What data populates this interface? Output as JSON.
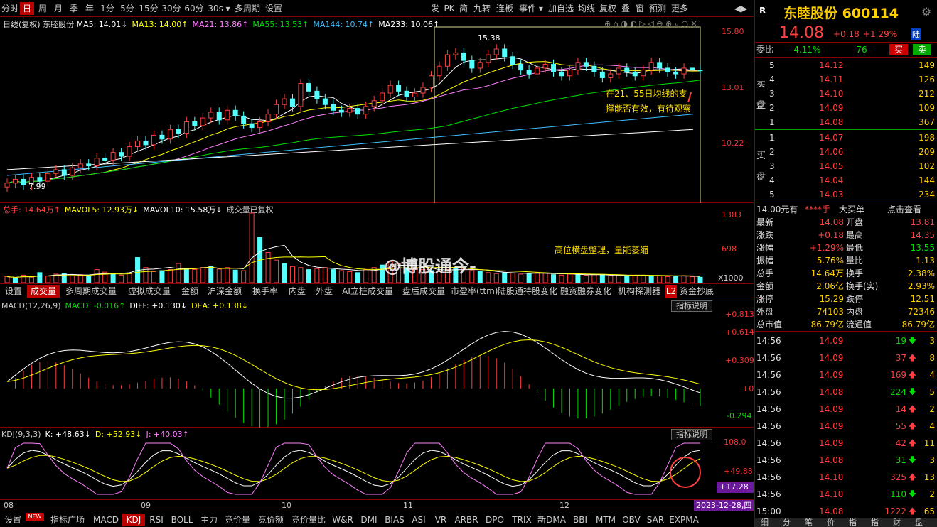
{
  "toolbar": {
    "left": [
      "分时",
      "日",
      "周",
      "月",
      "季",
      "年",
      "1分",
      "5分",
      "15分",
      "30分",
      "60分",
      "30s ▾",
      "多周期",
      "设置"
    ],
    "selected": "日",
    "right": [
      "发",
      "PK",
      "简",
      "九转",
      "连板",
      "事件 ▾",
      "加自选",
      "均线",
      "复权",
      "叠",
      "窗",
      "预测",
      "更多"
    ],
    "nav": "◀▶"
  },
  "main": {
    "mode": "日线(复权)",
    "name": "东睦股份",
    "ma": [
      {
        "t": "MA5: 14.01↓",
        "c": "#ffffff"
      },
      {
        "t": "MA13: 14.00↑",
        "c": "#ffff00"
      },
      {
        "t": "MA21: 13.86↑",
        "c": "#ff80ff"
      },
      {
        "t": "MA55: 13.53↑",
        "c": "#00e000"
      },
      {
        "t": "MA144: 10.74↑",
        "c": "#40c0ff"
      },
      {
        "t": "MA233: 10.06↑",
        "c": "#ffffff"
      }
    ],
    "yaxis": [
      "15.80",
      "13.01",
      "10.22"
    ],
    "high_label": "15.38",
    "low_label": "7.99",
    "annotation": [
      "在21、55日均线的支",
      "撑能否有效，有待观察"
    ],
    "candles": [
      8.2,
      8.4,
      8.1,
      8.5,
      8.3,
      8.7,
      8.9,
      8.6,
      9.0,
      9.2,
      9.1,
      9.5,
      9.4,
      9.8,
      9.6,
      10.1,
      10.4,
      10.2,
      10.7,
      10.5,
      11.0,
      10.8,
      11.4,
      11.2,
      11.6,
      11.9,
      11.5,
      12.0,
      11.7,
      11.3,
      11.1,
      11.4,
      11.8,
      12.3,
      12.6,
      12.2,
      13.4,
      13.0,
      12.6,
      12.3,
      12.0,
      11.9,
      12.1,
      11.8,
      12.2,
      12.5,
      12.9,
      13.3,
      13.0,
      12.7,
      12.9,
      13.2,
      13.8,
      14.3,
      14.9,
      15.0,
      14.6,
      14.2,
      14.5,
      14.9,
      15.2,
      14.8,
      14.4,
      14.1,
      13.9,
      14.2,
      14.4,
      14.0,
      13.8,
      14.1,
      14.5,
      14.3,
      14.0,
      13.7,
      13.9,
      14.2,
      14.0,
      13.8,
      14.1,
      14.5,
      14.2,
      14.0,
      13.9,
      14.2,
      14.1,
      14.08
    ]
  },
  "vol": {
    "items": [
      {
        "t": "总手: 14.64万↑",
        "c": "#ff4040"
      },
      {
        "t": "MAVOL5: 12.93万↓",
        "c": "#ffff00"
      },
      {
        "t": "MAVOL10: 15.58万↓",
        "c": "#ffffff"
      },
      {
        "t": "成交量已复权",
        "c": "#cccccc"
      }
    ],
    "yaxis": [
      "1383",
      "698"
    ],
    "unit": "X1000",
    "note": "高位横盘整理，量能萎缩",
    "bars": [
      120,
      90,
      150,
      110,
      200,
      130,
      170,
      180,
      140,
      160,
      120,
      260,
      210,
      190,
      150,
      180,
      500,
      300,
      220,
      240,
      260,
      380,
      280,
      260,
      300,
      320,
      270,
      300,
      250,
      240,
      1383,
      900,
      600,
      450,
      380,
      320,
      300,
      260,
      280,
      300,
      260,
      240,
      220,
      200,
      260,
      300,
      350,
      420,
      380,
      300,
      280,
      260,
      240,
      220,
      260,
      300,
      280,
      240,
      220,
      200,
      180,
      200,
      190,
      170,
      180,
      200,
      190,
      160,
      150,
      170,
      160,
      150,
      160,
      150,
      140,
      150,
      130,
      140,
      150,
      130,
      140,
      120,
      130,
      140,
      120,
      110
    ]
  },
  "vtabs": [
    "设置",
    "成交量",
    "多周期成交量",
    "虚拟成交量",
    "金额",
    "沪深金额",
    "换手率",
    "内盘",
    "外盘",
    "AI立桩成交量",
    "盘后成交量",
    "市盈率(ttm)",
    "陆股通持股变化",
    "融资融券变化",
    "机构探测器",
    "L2",
    "资金抄底"
  ],
  "macd": {
    "items": [
      {
        "t": "MACD(12,26,9)",
        "c": "#cccccc"
      },
      {
        "t": "MACD: -0.016↑",
        "c": "#00e000"
      },
      {
        "t": "DIFF: +0.130↓",
        "c": "#ffffff"
      },
      {
        "t": "DEA: +0.138↓",
        "c": "#ffff00"
      }
    ],
    "yaxis": [
      "+0.813",
      "+0.614",
      "+0.309",
      "+0",
      "-0.294"
    ],
    "btn": "指标说明"
  },
  "kdj": {
    "items": [
      {
        "t": "KDJ(9,3,3)",
        "c": "#cccccc"
      },
      {
        "t": "K: +48.63↓",
        "c": "#ffffff"
      },
      {
        "t": "D: +52.93↓",
        "c": "#ffff00"
      },
      {
        "t": "J: +40.03↑",
        "c": "#ff80ff"
      }
    ],
    "yaxis": [
      "108.0",
      "+49.88"
    ],
    "last": "+17.28",
    "btn": "指标说明"
  },
  "xaxis": [
    "08",
    "09",
    "10",
    "11",
    "12"
  ],
  "date": "2023-12-28,四",
  "btabs": [
    "设置",
    "指标广场",
    "MACD",
    "KDJ",
    "RSI",
    "BOLL",
    "主力",
    "竞价量",
    "竞价额",
    "竞价量比",
    "W&R",
    "DMI",
    "BIAS",
    "ASI",
    "VR",
    "ARBR",
    "DPO",
    "TRIX",
    "新DMA",
    "BBI",
    "MTM",
    "OBV",
    "SAR",
    "EXPMA"
  ],
  "new_badge": "NEW",
  "quote": {
    "flag": "R",
    "name": "东睦股份",
    "code": "600114",
    "price": "14.08",
    "chg": "+0.18",
    "pct": "+1.29%",
    "mkt": "陆",
    "weibi_label": "委比",
    "weibi": "-4.11%",
    "weicha": "-76",
    "buy": "买",
    "sell": "卖",
    "sell_side": "卖盘",
    "buy_side": "买盘",
    "asks": [
      [
        "5",
        "14.12",
        "149"
      ],
      [
        "4",
        "14.11",
        "126"
      ],
      [
        "3",
        "14.10",
        "212"
      ],
      [
        "2",
        "14.09",
        "109"
      ],
      [
        "1",
        "14.08",
        "367"
      ]
    ],
    "bids": [
      [
        "1",
        "14.07",
        "198"
      ],
      [
        "2",
        "14.06",
        "209"
      ],
      [
        "3",
        "14.05",
        "102"
      ],
      [
        "4",
        "14.04",
        "144"
      ],
      [
        "5",
        "14.03",
        "234"
      ]
    ],
    "bigorder": "14.00元有",
    "bigorder_mask": "****手",
    "bigorder_txt": "大买单",
    "bigorder_link": "点击查看",
    "stats": [
      [
        "最新",
        "14.08",
        "开盘",
        "13.81"
      ],
      [
        "涨跌",
        "+0.18",
        "最高",
        "14.35"
      ],
      [
        "涨幅",
        "+1.29%",
        "最低",
        "13.55"
      ],
      [
        "振幅",
        "5.76%",
        "量比",
        "1.13"
      ],
      [
        "总手",
        "14.64万",
        "换手",
        "2.38%"
      ],
      [
        "金额",
        "2.06亿",
        "换手(实)",
        "2.93%"
      ],
      [
        "涨停",
        "15.29",
        "跌停",
        "12.51"
      ],
      [
        "外盘",
        "74103",
        "内盘",
        "72346"
      ],
      [
        "总市值",
        "86.79亿",
        "流通值",
        "86.79亿"
      ]
    ],
    "ticks": [
      [
        "14:56",
        "14.09",
        "19",
        "d",
        "3"
      ],
      [
        "14:56",
        "14.09",
        "37",
        "u",
        "8"
      ],
      [
        "14:56",
        "14.09",
        "169",
        "u",
        "4"
      ],
      [
        "14:56",
        "14.08",
        "224",
        "d",
        "5"
      ],
      [
        "14:56",
        "14.09",
        "14",
        "u",
        "2"
      ],
      [
        "14:56",
        "14.09",
        "55",
        "u",
        "4"
      ],
      [
        "14:56",
        "14.09",
        "42",
        "u",
        "11"
      ],
      [
        "14:56",
        "14.08",
        "31",
        "d",
        "3"
      ],
      [
        "14:56",
        "14.10",
        "325",
        "u",
        "13"
      ],
      [
        "14:56",
        "14.10",
        "110",
        "d",
        "2"
      ],
      [
        "15:00",
        "14.08",
        "1222",
        "u",
        "65"
      ]
    ],
    "btm": [
      "细",
      "分",
      "笔",
      "价",
      "指",
      "指",
      "财",
      "盘"
    ]
  },
  "watermark": "@博股通今-"
}
